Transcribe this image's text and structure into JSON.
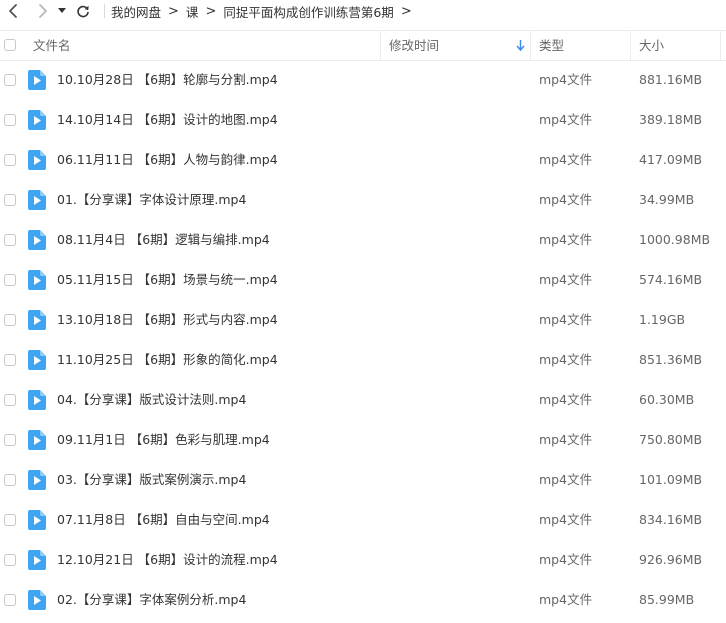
{
  "breadcrumb": [
    "我的网盘",
    "课",
    "同捉平面构成创作训练营第6期"
  ],
  "columns": {
    "name": "文件名",
    "modified": "修改时间",
    "type": "类型",
    "size": "大小"
  },
  "files": [
    {
      "name": "10.10月28日 【6期】轮廓与分割.mp4",
      "type": "mp4文件",
      "size": "881.16MB"
    },
    {
      "name": "14.10月14日 【6期】设计的地图.mp4",
      "type": "mp4文件",
      "size": "389.18MB"
    },
    {
      "name": "06.11月11日 【6期】人物与韵律.mp4",
      "type": "mp4文件",
      "size": "417.09MB"
    },
    {
      "name": "01.【分享课】字体设计原理.mp4",
      "type": "mp4文件",
      "size": "34.99MB"
    },
    {
      "name": "08.11月4日 【6期】逻辑与编排.mp4",
      "type": "mp4文件",
      "size": "1000.98MB"
    },
    {
      "name": "05.11月15日 【6期】场景与统一.mp4",
      "type": "mp4文件",
      "size": "574.16MB"
    },
    {
      "name": "13.10月18日 【6期】形式与内容.mp4",
      "type": "mp4文件",
      "size": "1.19GB"
    },
    {
      "name": "11.10月25日 【6期】形象的简化.mp4",
      "type": "mp4文件",
      "size": "851.36MB"
    },
    {
      "name": "04.【分享课】版式设计法则.mp4",
      "type": "mp4文件",
      "size": "60.30MB"
    },
    {
      "name": "09.11月1日 【6期】色彩与肌理.mp4",
      "type": "mp4文件",
      "size": "750.80MB"
    },
    {
      "name": "03.【分享课】版式案例演示.mp4",
      "type": "mp4文件",
      "size": "101.09MB"
    },
    {
      "name": "07.11月8日 【6期】自由与空间.mp4",
      "type": "mp4文件",
      "size": "834.16MB"
    },
    {
      "name": "12.10月21日 【6期】设计的流程.mp4",
      "type": "mp4文件",
      "size": "926.96MB"
    },
    {
      "name": "02.【分享课】字体案例分析.mp4",
      "type": "mp4文件",
      "size": "85.99MB"
    }
  ],
  "colors": {
    "icon_blue": "#3fa4f2",
    "sort_arrow": "#3b8ef0"
  }
}
